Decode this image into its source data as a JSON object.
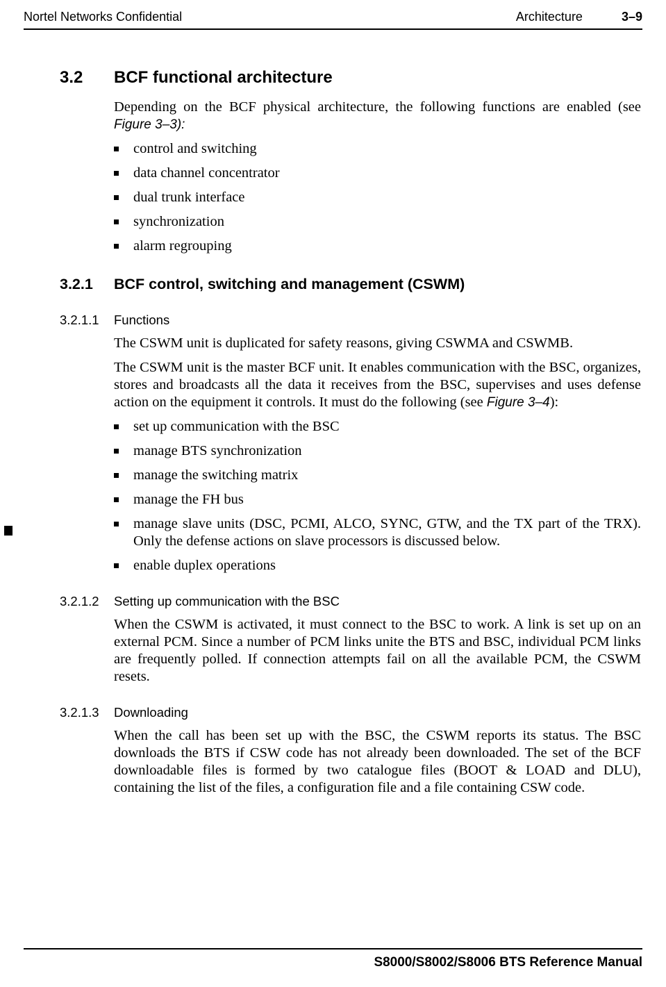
{
  "header": {
    "left": "Nortel Networks Confidential",
    "center": "Architecture",
    "right": "3–9"
  },
  "section": {
    "num": "3.2",
    "title": "BCF functional architecture",
    "intro_a": "Depending on the BCF physical architecture, the following functions are enabled (see ",
    "intro_fig": "Figure 3–3):",
    "bullets": [
      "control and switching",
      "data channel concentrator",
      "dual trunk interface",
      "synchronization",
      "alarm regrouping"
    ]
  },
  "sub321": {
    "num": "3.2.1",
    "title": "BCF control, switching and management (CSWM)"
  },
  "sub3211": {
    "num": "3.2.1.1",
    "title": "Functions",
    "p1": "The CSWM unit is duplicated for safety reasons, giving CSWMA and CSWMB.",
    "p2a": "The CSWM unit is the master BCF unit. It enables communication with the BSC, organizes, stores and broadcasts all the data it receives from the BSC, supervises and uses defense action on the equipment it controls. It must do the following (see ",
    "p2fig": "Figure 3–4",
    "p2b": "):",
    "bullets": [
      "set up communication with the BSC",
      "manage BTS synchronization",
      "manage the switching matrix",
      "manage the FH bus",
      "manage slave units (DSC, PCMI, ALCO, SYNC, GTW, and the TX part of the TRX). Only the defense actions on slave processors is discussed below.",
      "enable duplex operations"
    ]
  },
  "sub3212": {
    "num": "3.2.1.2",
    "title": "Setting up communication with the BSC",
    "p1": "When the CSWM is activated, it must connect to the BSC to work. A link is set up on an external PCM. Since a number of PCM links unite the BTS and BSC, individual PCM links are frequently polled. If connection attempts fail on all the available PCM, the CSWM resets."
  },
  "sub3213": {
    "num": "3.2.1.3",
    "title": "Downloading",
    "p1": "When the call has been set up with the BSC, the CSWM reports its status. The BSC downloads the BTS if CSW code has not already been downloaded. The set of the BCF downloadable files is formed by two catalogue files (BOOT & LOAD and DLU), containing the list of the files, a configuration file and a file containing CSW code."
  },
  "footer": {
    "text": "S8000/S8002/S8006 BTS Reference Manual"
  }
}
